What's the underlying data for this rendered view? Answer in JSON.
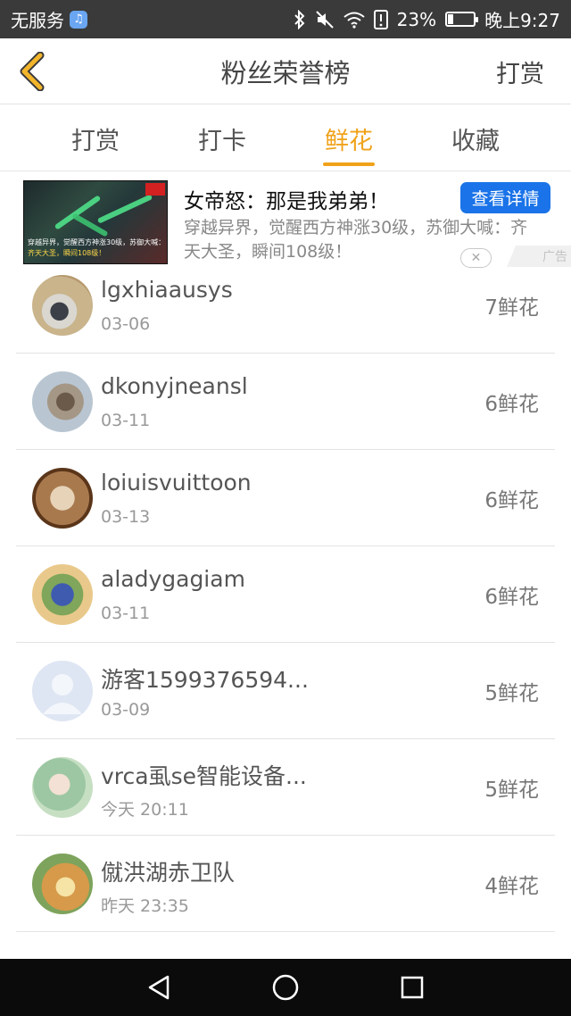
{
  "status_bar": {
    "carrier": "无服务",
    "battery_percent_text": "23%",
    "battery_level": 0.23,
    "time": "晚上9:27"
  },
  "header": {
    "title": "粉丝荣誉榜",
    "action_label": "打赏"
  },
  "tabs": [
    {
      "label": "打赏",
      "active": false
    },
    {
      "label": "打卡",
      "active": false
    },
    {
      "label": "鲜花",
      "active": true
    },
    {
      "label": "收藏",
      "active": false
    }
  ],
  "ad": {
    "title": "女帝怒：那是我弟弟！",
    "description": "穿越异界，觉醒西方神涨30级，苏御大喊：齐天大圣，瞬间108级！",
    "cta": "查看详情",
    "label": "广告",
    "image_caption_1": "穿越异界，觉醒西方神涨30级，苏御大喊：",
    "image_caption_2": "齐天大圣，瞬间108级！"
  },
  "rows": [
    {
      "name": "lgxhiaausys",
      "date": "03-06",
      "count": "7鲜花"
    },
    {
      "name": "dkonyjneansl",
      "date": "03-11",
      "count": "6鲜花"
    },
    {
      "name": "loiuisvuittoon",
      "date": "03-13",
      "count": "6鲜花"
    },
    {
      "name": "aladygagiam",
      "date": "03-11",
      "count": "6鲜花"
    },
    {
      "name": "游客1599376594...",
      "date": "03-09",
      "count": "5鲜花"
    },
    {
      "name": "vrca虱se智能设备...",
      "date": "今天 20:11",
      "count": "5鲜花"
    },
    {
      "name": "僦洪湖赤卫队",
      "date": "昨天 23:35",
      "count": "4鲜花"
    }
  ],
  "colors": {
    "accent": "#f0a21a",
    "cta_blue": "#1a73e8",
    "status_bar_bg": "#3a3a3a",
    "nav_bar_bg": "#0b0b0b"
  }
}
